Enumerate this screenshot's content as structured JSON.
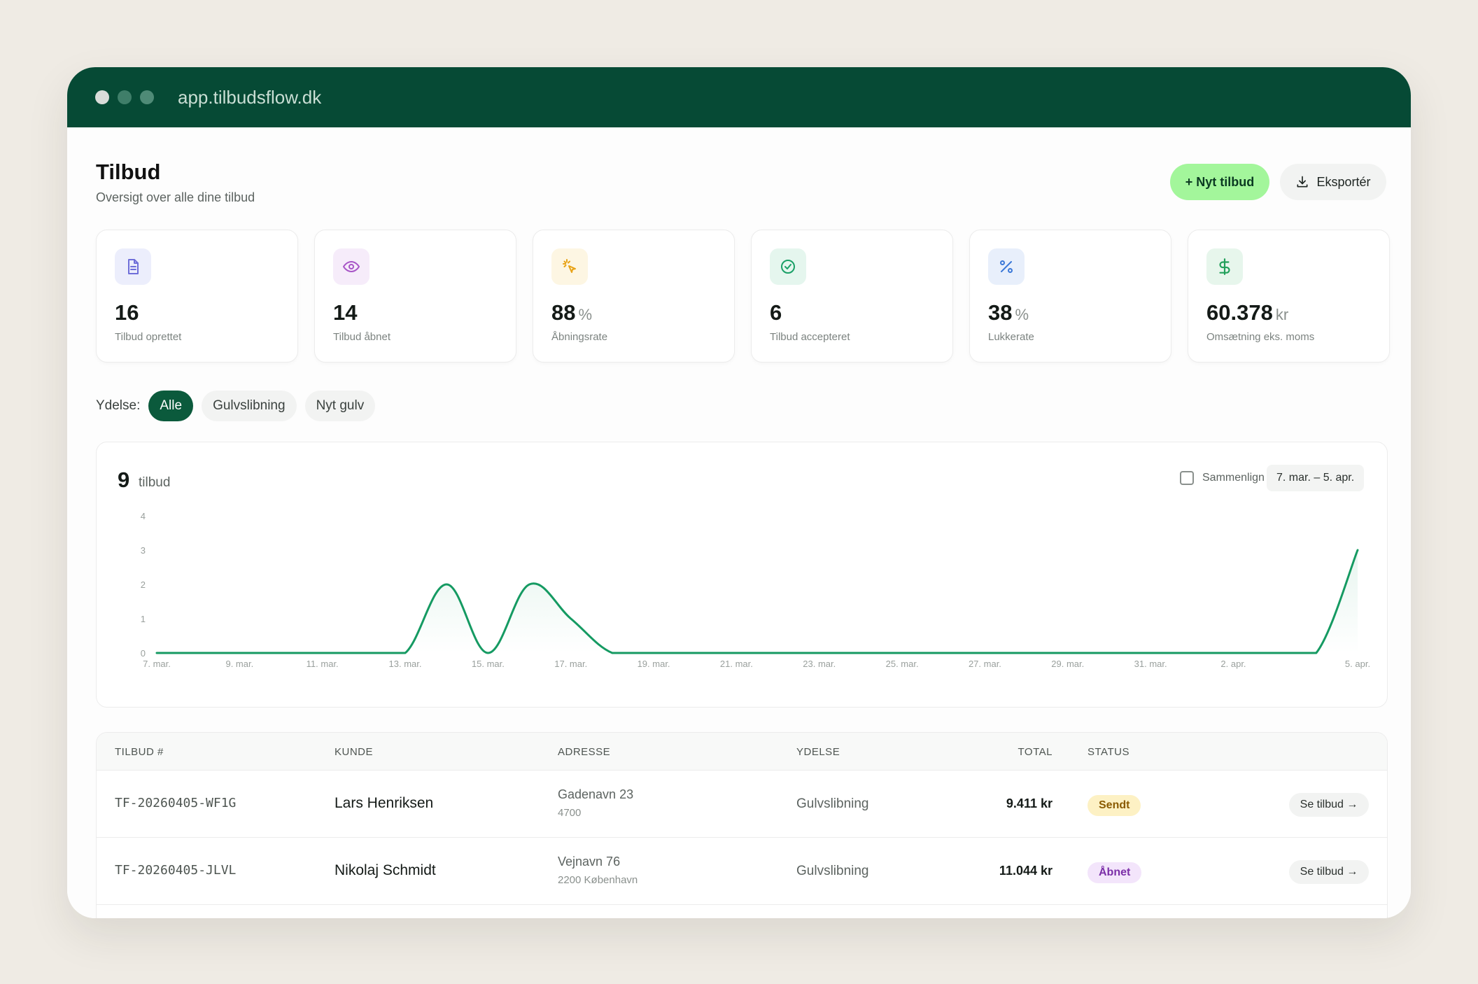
{
  "window": {
    "url": "app.tilbudsflow.dk"
  },
  "header": {
    "title": "Tilbud",
    "subtitle": "Oversigt over alle dine tilbud",
    "new_button": "+ Nyt tilbud",
    "export_button": "Eksportér"
  },
  "stats": [
    {
      "value": "16",
      "unit": "",
      "label": "Tilbud oprettet",
      "icon": "document-icon",
      "color": "#6f6fd9",
      "bg": "#eceefc"
    },
    {
      "value": "14",
      "unit": "",
      "label": "Tilbud åbnet",
      "icon": "eye-icon",
      "color": "#a855c7",
      "bg": "#f6ecfa"
    },
    {
      "value": "88",
      "unit": "%",
      "label": "Åbningsrate",
      "icon": "cursor-click-icon",
      "color": "#e8a317",
      "bg": "#fdf6e3"
    },
    {
      "value": "6",
      "unit": "",
      "label": "Tilbud accepteret",
      "icon": "check-circle-icon",
      "color": "#1aa067",
      "bg": "#e5f6ee"
    },
    {
      "value": "38",
      "unit": "%",
      "label": "Lukkerate",
      "icon": "percent-icon",
      "color": "#3b78d8",
      "bg": "#e8effb"
    },
    {
      "value": "60.378",
      "unit": "kr",
      "label": "Omsætning eks. moms",
      "icon": "dollar-icon",
      "color": "#22a05a",
      "bg": "#e7f6ec"
    }
  ],
  "filter": {
    "label": "Ydelse:",
    "options": [
      "Alle",
      "Gulvslibning",
      "Nyt gulv"
    ],
    "selected": "Alle"
  },
  "chart": {
    "count": "9",
    "count_label": "tilbud",
    "compare_label": "Sammenlign",
    "date_range": "7. mar. – 5. apr."
  },
  "chart_data": {
    "type": "area",
    "title": "",
    "xlabel": "",
    "ylabel": "",
    "ylim": [
      0,
      4
    ],
    "yticks": [
      0,
      1,
      2,
      3,
      4
    ],
    "x_tick_labels": [
      "7. mar.",
      "9. mar.",
      "11. mar.",
      "13. mar.",
      "15. mar.",
      "17. mar.",
      "19. mar.",
      "21. mar.",
      "23. mar.",
      "25. mar.",
      "27. mar.",
      "29. mar.",
      "31. mar.",
      "2. apr.",
      "5. apr."
    ],
    "x": [
      "7. mar.",
      "8. mar.",
      "9. mar.",
      "10. mar.",
      "11. mar.",
      "12. mar.",
      "13. mar.",
      "14. mar.",
      "15. mar.",
      "16. mar.",
      "17. mar.",
      "18. mar.",
      "19. mar.",
      "20. mar.",
      "21. mar.",
      "22. mar.",
      "23. mar.",
      "24. mar.",
      "25. mar.",
      "26. mar.",
      "27. mar.",
      "28. mar.",
      "29. mar.",
      "30. mar.",
      "31. mar.",
      "1. apr.",
      "2. apr.",
      "3. apr.",
      "4. apr.",
      "5. apr."
    ],
    "values": [
      0,
      0,
      0,
      0,
      0,
      0,
      0,
      2,
      0,
      2,
      1,
      0,
      0,
      0,
      0,
      0,
      0,
      0,
      0,
      0,
      0,
      0,
      0,
      0,
      0,
      0,
      0,
      0,
      0,
      3
    ],
    "grid": false,
    "line_color": "#159a62"
  },
  "table": {
    "columns": [
      "TILBUD #",
      "KUNDE",
      "ADRESSE",
      "YDELSE",
      "TOTAL",
      "STATUS"
    ],
    "rows": [
      {
        "id": "TF-20260405-WF1G",
        "customer": "Lars Henriksen",
        "address1": "Gadenavn 23",
        "address2": "4700",
        "service": "Gulvslibning",
        "total": "9.411 kr",
        "status": "Sendt",
        "action": "Se tilbud →"
      },
      {
        "id": "TF-20260405-JLVL",
        "customer": "Nikolaj Schmidt",
        "address1": "Vejnavn 76",
        "address2": "2200 København",
        "service": "Gulvslibning",
        "total": "11.044 kr",
        "status": "Åbnet",
        "action": "Se tilbud →"
      }
    ]
  }
}
